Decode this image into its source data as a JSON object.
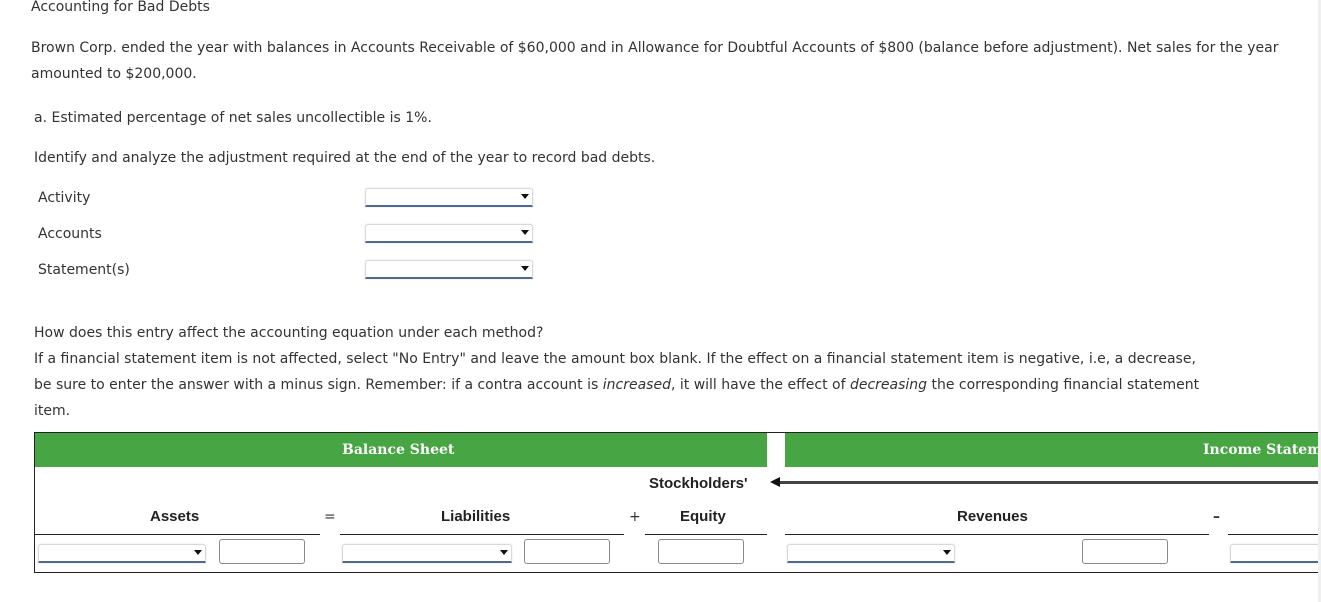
{
  "page": {
    "title": "Accounting for Bad Debts",
    "intro": "Brown Corp. ended the year with balances in Accounts Receivable of $60,000 and in Allowance for Doubtful Accounts of $800 (balance before adjustment). Net sales for the year amounted to $200,000.",
    "part_a": "a. Estimated percentage of net sales uncollectible is 1%.",
    "instruction": "Identify and analyze the adjustment required at the end of the year to record bad debts."
  },
  "analysis": {
    "rows": [
      {
        "label": "Activity",
        "selected": ""
      },
      {
        "label": "Accounts",
        "selected": ""
      },
      {
        "label": "Statement(s)",
        "selected": ""
      }
    ]
  },
  "equation_question": {
    "question": "How does this entry affect the accounting equation under each method?",
    "line1": "If a financial statement item is not affected, select \"No Entry\" and leave the amount box blank. If the effect on a financial statement item is negative, i.e, a decrease,",
    "line2_pre": "be sure to enter the answer with a minus sign. Remember: if a contra account is ",
    "line2_em1": "increased",
    "line2_mid": ", it will have the effect of ",
    "line2_em2": "decreasing",
    "line2_post": " the corresponding financial statement",
    "line3": "item."
  },
  "table": {
    "balance_sheet_header": "Balance Sheet",
    "income_statement_header": "Income Statement",
    "columns": {
      "assets": "Assets",
      "equals": "=",
      "liabilities": "Liabilities",
      "plus": "+",
      "equity_line1": "Stockholders'",
      "equity_line2": "Equity",
      "revenues": "Revenues",
      "minus": "–"
    },
    "inputs": {
      "assets_account": "",
      "assets_amount": "",
      "liabilities_account": "",
      "liabilities_amount": "",
      "equity_amount": "",
      "revenues_account": "",
      "revenues_amount": "",
      "expenses_account": ""
    },
    "colors": {
      "header_green": "#47a543",
      "select_underline": "#4d6a94"
    }
  }
}
